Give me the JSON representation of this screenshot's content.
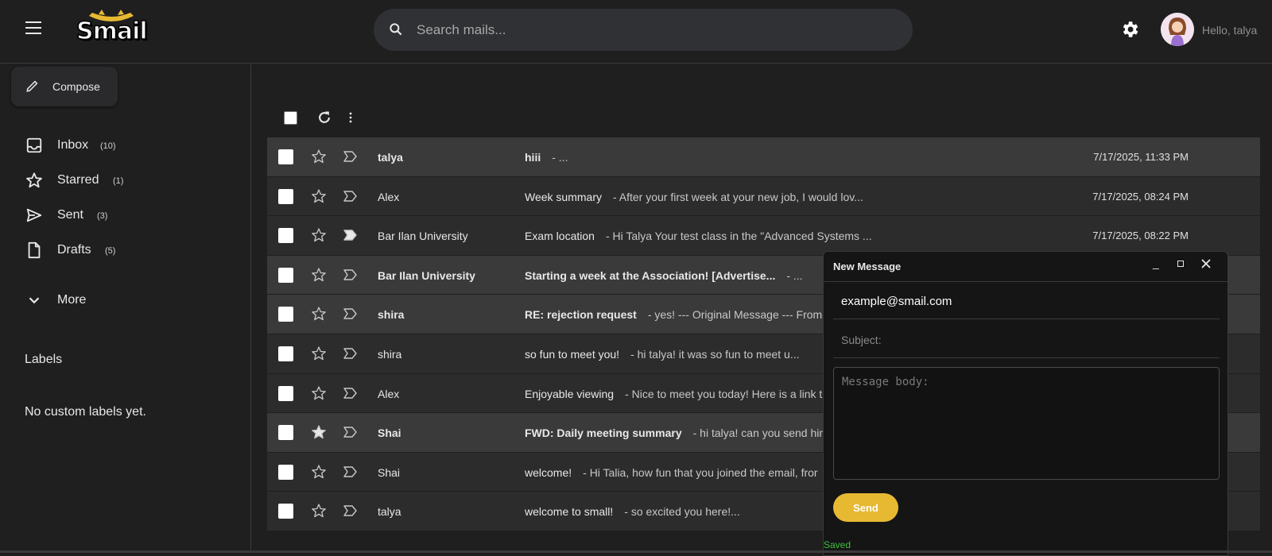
{
  "header": {
    "logo_text": "Smail",
    "search_placeholder": "Search mails...",
    "greeting": "Hello, talya"
  },
  "sidebar": {
    "compose_label": "Compose",
    "items": [
      {
        "label": "Inbox",
        "count": "(10)",
        "icon": "inbox-icon"
      },
      {
        "label": "Starred",
        "count": "(1)",
        "icon": "star-icon"
      },
      {
        "label": "Sent",
        "count": "(3)",
        "icon": "send-icon"
      },
      {
        "label": "Drafts",
        "count": "(5)",
        "icon": "draft-icon"
      },
      {
        "label": "More",
        "count": "",
        "icon": "chevron-down-icon"
      }
    ],
    "labels_title": "Labels",
    "labels_empty": "No custom labels yet."
  },
  "emails": [
    {
      "sender": "talya",
      "subject": "hiii",
      "snippet": "- ...",
      "date": "7/17/2025, 11:33 PM",
      "unread": true,
      "starred": false,
      "important": false
    },
    {
      "sender": "Alex",
      "subject": "Week summary",
      "snippet": "- After your first week at your new job, I would lov...",
      "date": "7/17/2025, 08:24 PM",
      "unread": false,
      "starred": false,
      "important": false
    },
    {
      "sender": "Bar Ilan University",
      "subject": "Exam location",
      "snippet": "- Hi Talya Your test class in the \"Advanced Systems ...",
      "date": "7/17/2025, 08:22 PM",
      "unread": false,
      "starred": false,
      "important": true
    },
    {
      "sender": "Bar Ilan University",
      "subject": "Starting a week at the Association! [Advertise...",
      "snippet": "- ...",
      "date": "",
      "unread": true,
      "starred": false,
      "important": false
    },
    {
      "sender": "shira",
      "subject": "RE: rejection request",
      "snippet": "- yes! --- Original Message --- From: T",
      "date": "",
      "unread": true,
      "starred": false,
      "important": false
    },
    {
      "sender": "shira",
      "subject": "so fun to meet you!",
      "snippet": "- hi talya! it was so fun to meet u...",
      "date": "",
      "unread": false,
      "starred": false,
      "important": false
    },
    {
      "sender": "Alex",
      "subject": "Enjoyable viewing",
      "snippet": "- Nice to meet you today! Here is a link t",
      "date": "",
      "unread": false,
      "starred": false,
      "important": false
    },
    {
      "sender": "Shai",
      "subject": "FWD: Daily meeting summary",
      "snippet": "- hi talya! can you send him",
      "date": "",
      "unread": true,
      "starred": true,
      "important": false
    },
    {
      "sender": "Shai",
      "subject": "welcome!",
      "snippet": "- Hi Talia, how fun that you joined the email, fror",
      "date": "",
      "unread": false,
      "starred": false,
      "important": false
    },
    {
      "sender": "talya",
      "subject": "welcome to small!",
      "snippet": "- so excited you here!...",
      "date": "",
      "unread": false,
      "starred": false,
      "important": false
    }
  ],
  "composer": {
    "title": "New Message",
    "minimize_label": "_",
    "to_value": "example@smail.com",
    "subject_placeholder": "Subject:",
    "body_placeholder": "Message body:",
    "send_label": "Send",
    "status": "Saved"
  },
  "colors": {
    "accent": "#e7b932",
    "background": "#1f1f1f",
    "unread_row": "#3a3a3a",
    "read_row": "#2c2c2c",
    "saved_text": "#3fbf3f"
  }
}
